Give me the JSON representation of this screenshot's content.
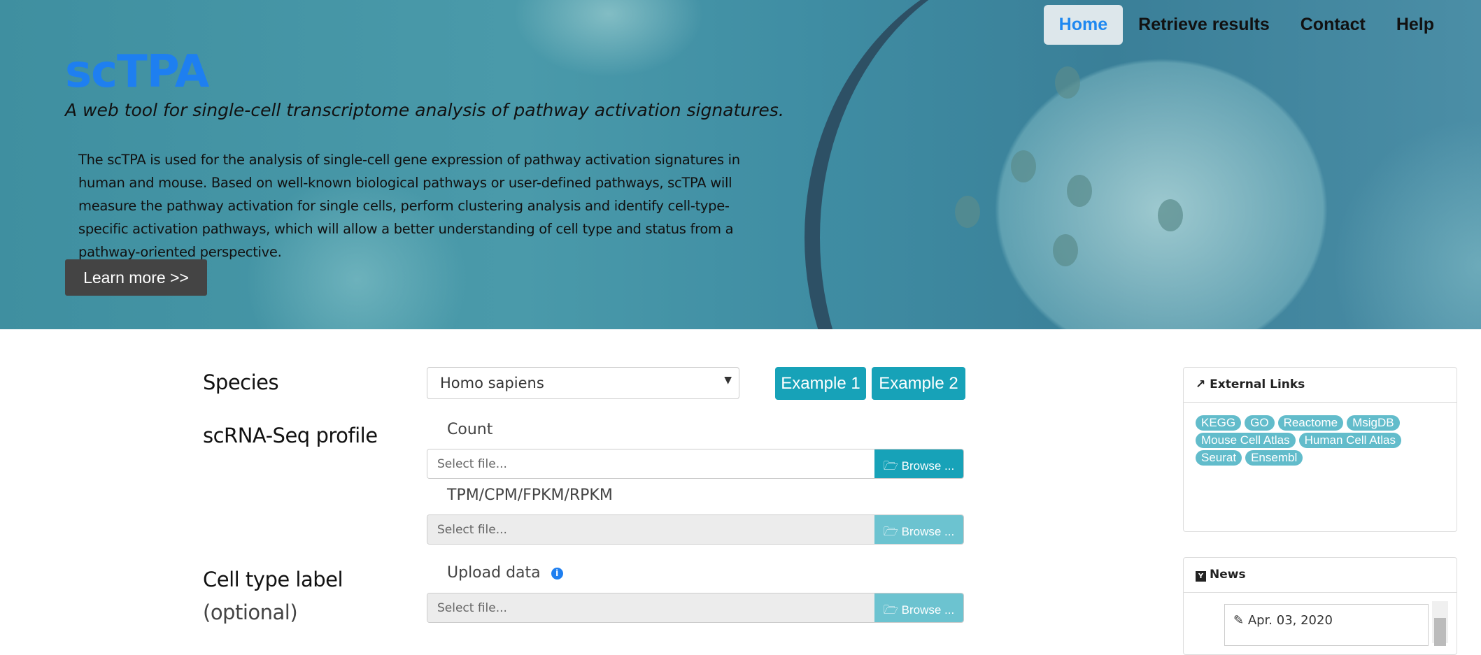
{
  "nav": {
    "items": [
      {
        "label": "Home",
        "active": true
      },
      {
        "label": "Retrieve results"
      },
      {
        "label": "Contact"
      },
      {
        "label": "Help"
      }
    ]
  },
  "hero": {
    "title": "scTPA",
    "tagline": "A web tool for single-cell transcriptome analysis of pathway activation signatures.",
    "description": "The scTPA is used for the analysis of single-cell gene expression of pathway activation signatures in human and mouse. Based on well-known biological pathways or user-defined pathways, scTPA will measure the pathway activation for single cells, perform clustering analysis and identify cell-type-specific activation pathways, which will allow a better understanding of cell type and status from a pathway-oriented perspective.",
    "learn_more": "Learn  more >>"
  },
  "form": {
    "species_label": "Species",
    "species_value": "Homo sapiens",
    "example1": "Example 1",
    "example2": "Example 2",
    "profile_label": "scRNA-Seq profile",
    "count_label": "Count",
    "tpm_label": "TPM/CPM/FPKM/RPKM",
    "celltype_label": "Cell type label",
    "optional": "(optional)",
    "upload_label": "Upload data",
    "file_placeholder": "Select file...",
    "browse": "Browse ..."
  },
  "sidebar": {
    "external_title": "External Links",
    "links": [
      "KEGG",
      "GO",
      "Reactome",
      "MsigDB",
      "Mouse Cell Atlas",
      "Human Cell Atlas",
      "Seurat",
      "Ensembl"
    ],
    "news_title": "News",
    "news_date": "Apr. 03, 2020"
  },
  "colors": {
    "accent": "#17a2b8",
    "brand": "#1e7ff0",
    "badge": "#62bccb"
  }
}
